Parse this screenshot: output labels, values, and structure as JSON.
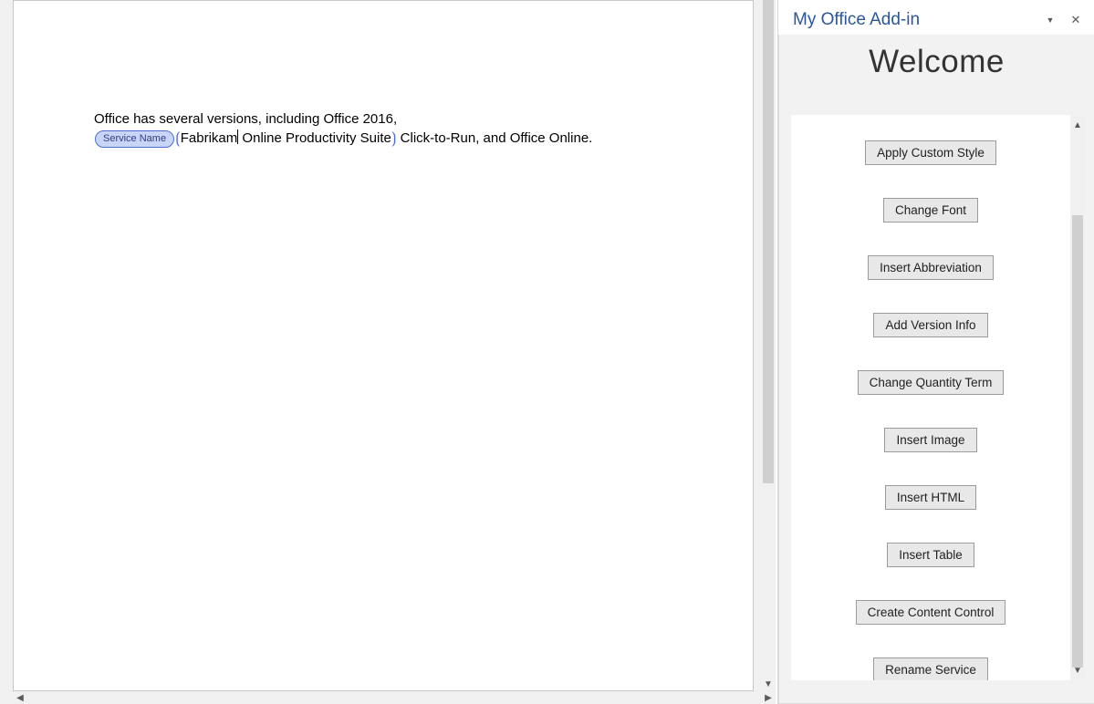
{
  "document": {
    "text_before": "Office has several versions, including Office 2016, ",
    "content_control_tag": "Service Name",
    "content_control_value_before_cursor": "Fabrikam",
    "content_control_value_after_cursor": " Online Productivity Suite",
    "text_after": " Click-to-Run, and Office Online."
  },
  "taskpane": {
    "title": "My Office Add-in",
    "welcome": "Welcome",
    "buttons": [
      "Apply Custom Style",
      "Change Font",
      "Insert Abbreviation",
      "Add Version Info",
      "Change Quantity Term",
      "Insert Image",
      "Insert HTML",
      "Insert Table",
      "Create Content Control",
      "Rename Service"
    ],
    "dropdown_glyph": "▼",
    "close_glyph": "✕"
  },
  "scroll_glyphs": {
    "up": "▲",
    "down": "▼",
    "left": "◀",
    "right": "▶"
  }
}
